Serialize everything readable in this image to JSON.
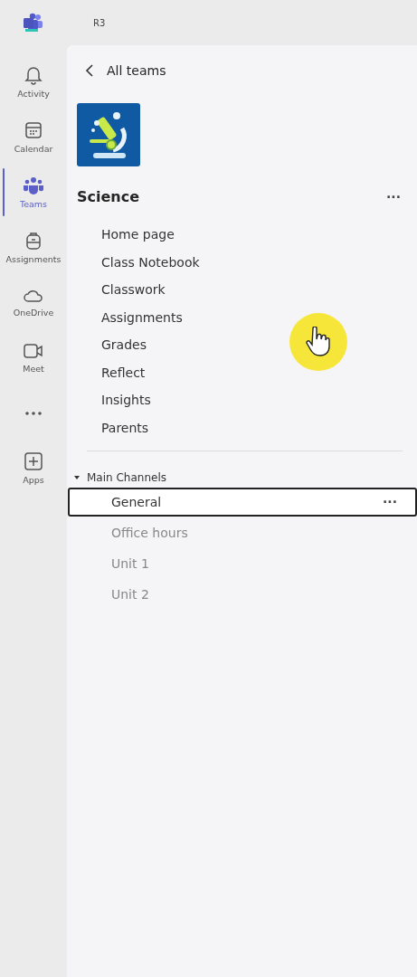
{
  "top_bar": {
    "title": "R3"
  },
  "rail": [
    {
      "label": "Activity",
      "selected": false
    },
    {
      "label": "Calendar",
      "selected": false
    },
    {
      "label": "Teams",
      "selected": true
    },
    {
      "label": "Assignments",
      "selected": false
    },
    {
      "label": "OneDrive",
      "selected": false
    },
    {
      "label": "Meet",
      "selected": false
    },
    {
      "selected": false
    },
    {
      "label": "Apps",
      "selected": false
    }
  ],
  "back_link": "All teams",
  "team": {
    "name": "Science",
    "more": "···"
  },
  "team_pages": [
    "Home page",
    "Class Notebook",
    "Classwork",
    "Assignments",
    "Grades",
    "Reflect",
    "Insights",
    "Parents"
  ],
  "channels": {
    "heading": "Main Channels",
    "expanded": true,
    "items": [
      {
        "name": "General",
        "selected": true
      },
      {
        "name": "Office hours",
        "selected": false
      },
      {
        "name": "Unit 1",
        "selected": false
      },
      {
        "name": "Unit 2",
        "selected": false
      }
    ]
  },
  "channel_more": "···"
}
